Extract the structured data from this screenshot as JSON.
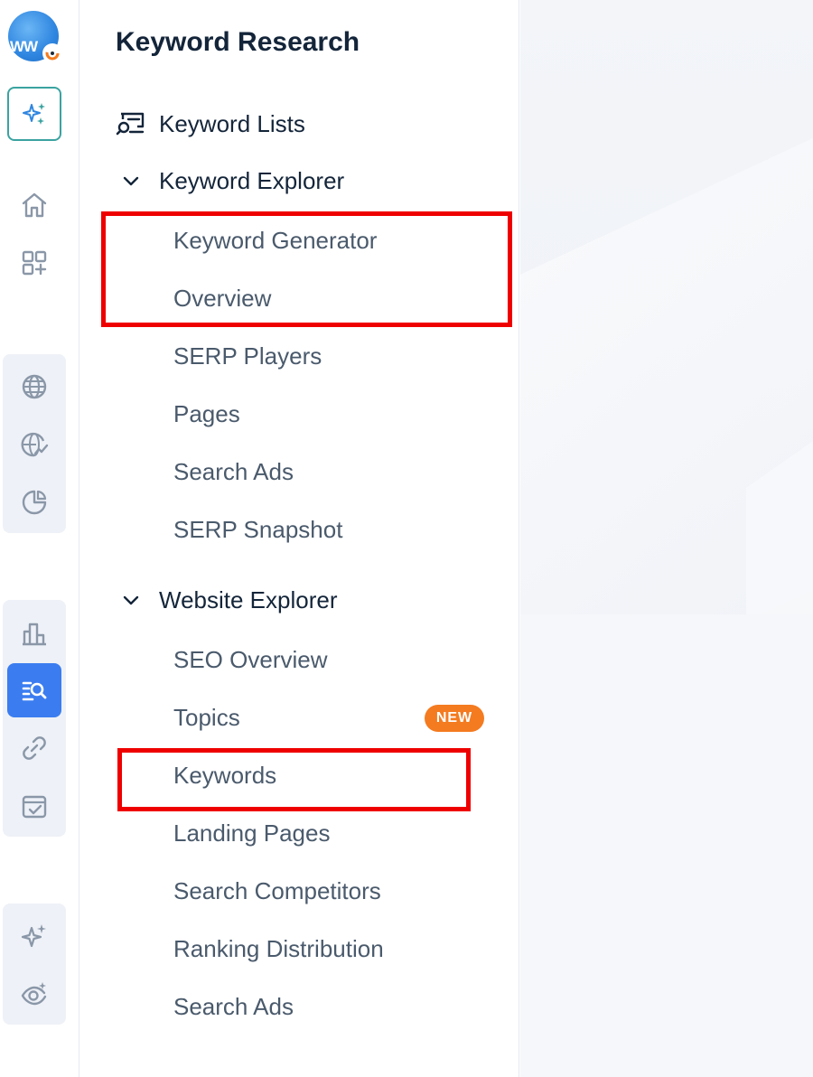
{
  "avatar": {
    "text": "WW"
  },
  "menu": {
    "title": "Keyword Research",
    "keyword_lists": "Keyword Lists",
    "keyword_explorer": {
      "label": "Keyword Explorer",
      "items": [
        "Keyword Generator",
        "Overview",
        "SERP Players",
        "Pages",
        "Search Ads",
        "SERP Snapshot"
      ]
    },
    "website_explorer": {
      "label": "Website Explorer",
      "items": [
        "SEO Overview",
        "Topics",
        "Keywords",
        "Landing Pages",
        "Search Competitors",
        "Ranking Distribution",
        "Search Ads"
      ],
      "new_badge": "NEW"
    }
  },
  "colors": {
    "highlight": "#ef0000",
    "active_rail": "#3b7df0",
    "badge": "#f47b20",
    "ai_border": "#3aa3a0"
  },
  "rail_icons": [
    "sparkles-icon",
    "home-icon",
    "apps-add-icon",
    "globe-icon",
    "globe-trend-icon",
    "pie-chart-icon",
    "bar-chart-icon",
    "keyword-research-icon",
    "link-icon",
    "calendar-check-icon",
    "sparkle-icon",
    "eye-sparkle-icon"
  ]
}
